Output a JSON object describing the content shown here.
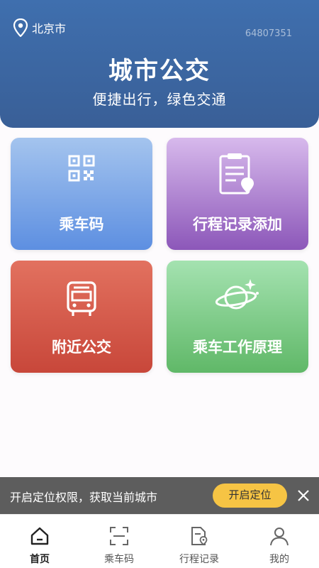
{
  "header": {
    "location": "北京市",
    "location_icon": "map-pin-icon",
    "device_id": "64807351",
    "title": "城市公交",
    "subtitle": "便捷出行，绿色交通",
    "bg_color": "#3d66a3"
  },
  "cards": [
    {
      "label": "乘车码",
      "icon": "qr-code-icon",
      "color": "#6f9be6"
    },
    {
      "label": "行程记录添加",
      "icon": "clipboard-location-icon",
      "color": "#a673cc"
    },
    {
      "label": "附近公交",
      "icon": "bus-icon",
      "color": "#d65a4a"
    },
    {
      "label": "乘车工作原理",
      "icon": "planet-icon",
      "color": "#7ccb84"
    }
  ],
  "banner": {
    "text": "开启定位权限，获取当前城市",
    "button_label": "开启定位",
    "button_color": "#f6c444",
    "close_icon": "close-icon"
  },
  "tabbar": {
    "items": [
      {
        "label": "首页",
        "icon": "home-icon",
        "active": true
      },
      {
        "label": "乘车码",
        "icon": "scan-icon",
        "active": false
      },
      {
        "label": "行程记录",
        "icon": "document-location-icon",
        "active": false
      },
      {
        "label": "我的",
        "icon": "user-icon",
        "active": false
      }
    ]
  }
}
